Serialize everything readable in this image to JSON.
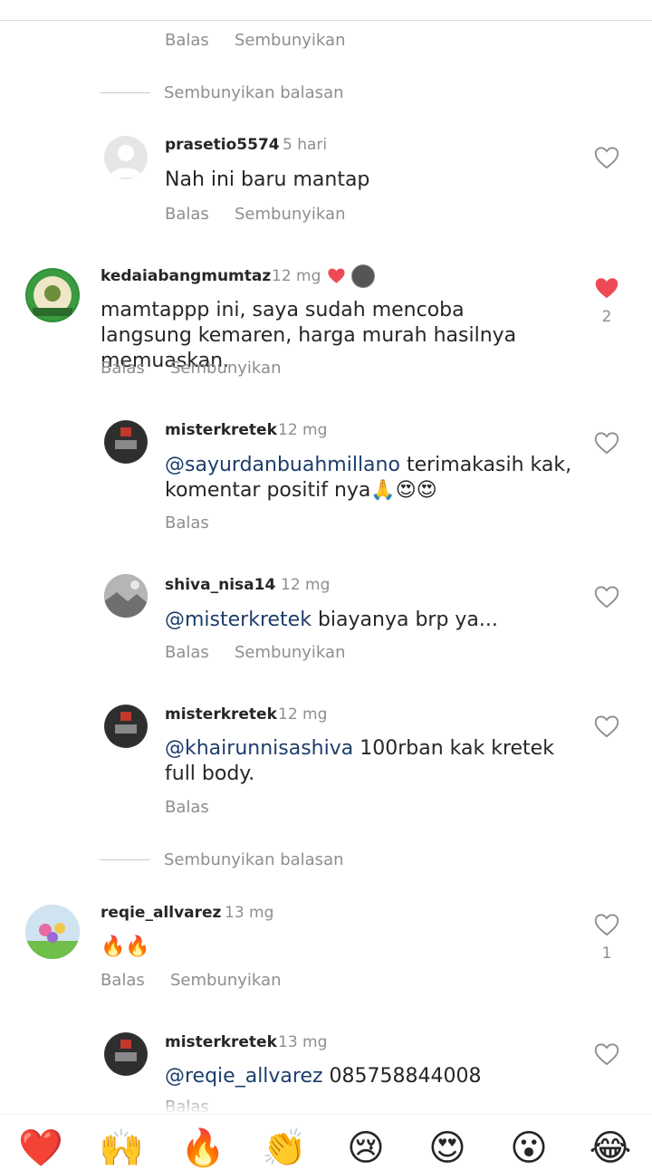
{
  "actions": {
    "reply": "Balas",
    "hide": "Sembunyikan",
    "hide_replies": "Sembunyikan balasan"
  },
  "comments": [
    {
      "user": "prasetio5574",
      "time": "5 hari",
      "text": "Nah ini baru mantap"
    },
    {
      "user": "kedaiabangmumtaz",
      "time": "12 mg",
      "text": "mamtappp ini, saya sudah mencoba langsung kemaren, harga murah hasilnya memuaskan.",
      "likes": "2"
    },
    {
      "user": "misterkretek",
      "time": "12 mg",
      "mention": "@sayurdanbuahmillano",
      "text": " terimakasih kak, komentar positif nya🙏😍😍"
    },
    {
      "user": "shiva_nisa14",
      "time": "12 mg",
      "mention": "@misterkretek",
      "text": " biayanya brp ya..."
    },
    {
      "user": "misterkretek",
      "time": "12 mg",
      "mention": "@khairunnisashiva",
      "text": " 100rban kak kretek full body."
    },
    {
      "user": "reqie_allvarez",
      "time": "13 mg",
      "text": "🔥🔥",
      "likes": "1"
    },
    {
      "user": "misterkretek",
      "time": "13 mg",
      "mention": "@reqie_allvarez",
      "text": " 085758844008"
    }
  ],
  "reaction_bar": [
    "❤️",
    "🙌",
    "🔥",
    "👏",
    "😢",
    "😍",
    "😮",
    "😂"
  ],
  "colors": {
    "liked": "#ed4956",
    "muted": "#8e8e8e",
    "mention": "#1d3d6b"
  }
}
